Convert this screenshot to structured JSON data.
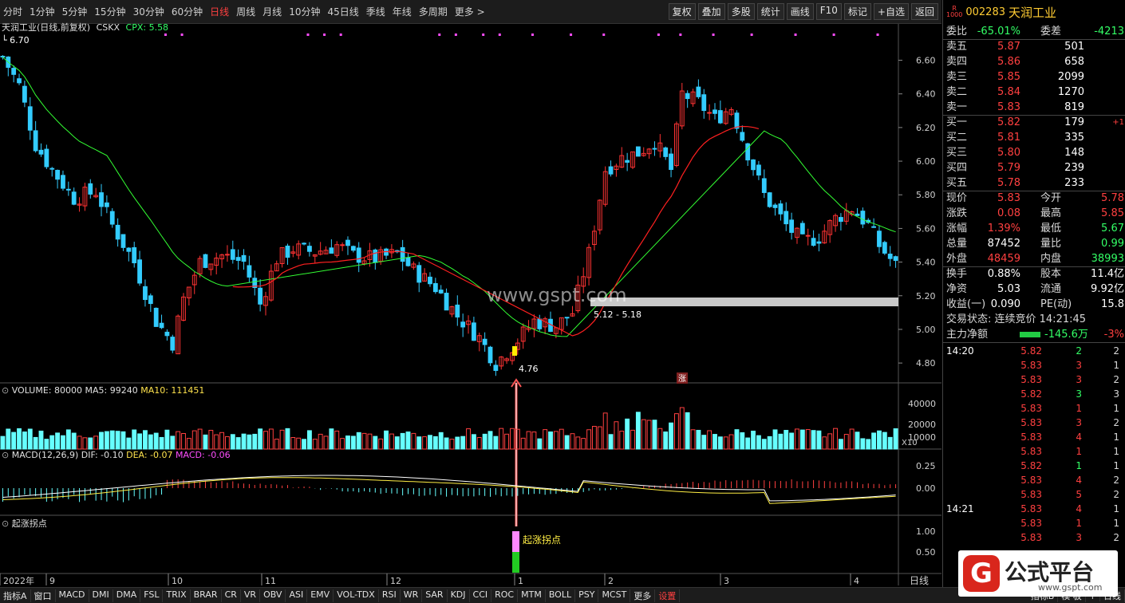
{
  "periods": [
    "分时",
    "1分钟",
    "5分钟",
    "15分钟",
    "30分钟",
    "60分钟",
    "日线",
    "周线",
    "月线",
    "10分钟",
    "45日线",
    "季线",
    "年线",
    "多周期",
    "更多 >"
  ],
  "active_period": "日线",
  "toolbar": [
    "复权",
    "叠加",
    "多股",
    "统计",
    "画线",
    "F10",
    "标记",
    "+自选",
    "返回"
  ],
  "main_title": "天润工业(日线,前复权)",
  "main_ind": "CSKX",
  "main_cpx": "CPX: 5.58",
  "high_label": "6.70",
  "low_label": "4.76",
  "range_label": "5.12 - 5.18",
  "watermark": "www.gspt.com",
  "rise_badge": "涨",
  "vol_title": "VOLUME: 80000",
  "vol_ma5": "MA5: 99240",
  "vol_ma10": "MA10: 111451",
  "macd_title": "MACD(12,26,9)",
  "macd_dif": "DIF: -0.10",
  "macd_dea": "DEA: -0.07",
  "macd_macd": "MACD: -0.06",
  "sig_title": "起涨拐点",
  "sig_label": "起涨拐点",
  "price_ticks": [
    "6.60",
    "6.40",
    "6.20",
    "6.00",
    "5.80",
    "5.60",
    "5.40",
    "5.20",
    "5.00",
    "4.80"
  ],
  "vol_ticks": [
    "40000",
    "20000",
    "10000"
  ],
  "vol_unit": "X10",
  "macd_ticks": [
    "0.25",
    "0.00"
  ],
  "sig_ticks": [
    "1.00",
    "0.50"
  ],
  "date_labels": [
    "2022年",
    "9",
    "10",
    "11",
    "12",
    "1",
    "2",
    "3",
    "4"
  ],
  "date_period": "日线",
  "bottom_tabs": [
    "指标A",
    "窗口",
    "MACD",
    "DMI",
    "DMA",
    "FSL",
    "TRIX",
    "BRAR",
    "CR",
    "VR",
    "OBV",
    "ASI",
    "EMV",
    "VOL-TDX",
    "RSI",
    "WR",
    "SAR",
    "KDJ",
    "CCI",
    "ROC",
    "MTM",
    "BOLL",
    "PSY",
    "MCST",
    "更多",
    "设置"
  ],
  "bottom_right": [
    "指标B",
    "模 板",
    "+",
    "日线"
  ],
  "stock": {
    "code": "002283",
    "name": "天润工业",
    "badge_top": "R",
    "badge_bottom": "1000"
  },
  "summary": {
    "wb_label": "委比",
    "wb": "-65.01%",
    "wc_label": "委差",
    "wc": "-4213"
  },
  "orderbook": [
    {
      "label": "卖五",
      "price": "5.87",
      "vol": "501",
      "chg": ""
    },
    {
      "label": "卖四",
      "price": "5.86",
      "vol": "658",
      "chg": ""
    },
    {
      "label": "卖三",
      "price": "5.85",
      "vol": "2099",
      "chg": ""
    },
    {
      "label": "卖二",
      "price": "5.84",
      "vol": "1270",
      "chg": ""
    },
    {
      "label": "卖一",
      "price": "5.83",
      "vol": "819",
      "chg": ""
    },
    {
      "label": "买一",
      "price": "5.82",
      "vol": "179",
      "chg": "+1"
    },
    {
      "label": "买二",
      "price": "5.81",
      "vol": "335",
      "chg": ""
    },
    {
      "label": "买三",
      "price": "5.80",
      "vol": "148",
      "chg": ""
    },
    {
      "label": "买四",
      "price": "5.79",
      "vol": "239",
      "chg": ""
    },
    {
      "label": "买五",
      "price": "5.78",
      "vol": "233",
      "chg": ""
    }
  ],
  "quote": [
    {
      "l1": "现价",
      "v1": "5.83",
      "c1": "r",
      "l2": "今开",
      "v2": "5.78",
      "c2": "r"
    },
    {
      "l1": "涨跌",
      "v1": "0.08",
      "c1": "r",
      "l2": "最高",
      "v2": "5.85",
      "c2": "r"
    },
    {
      "l1": "涨幅",
      "v1": "1.39%",
      "c1": "r",
      "l2": "最低",
      "v2": "5.67",
      "c2": "g"
    },
    {
      "l1": "总量",
      "v1": "87452",
      "c1": "w",
      "l2": "量比",
      "v2": "0.99",
      "c2": "g"
    },
    {
      "l1": "外盘",
      "v1": "48459",
      "c1": "r",
      "l2": "内盘",
      "v2": "38993",
      "c2": "g"
    }
  ],
  "stats": [
    {
      "l1": "换手",
      "v1": "0.88%",
      "l2": "股本",
      "v2": "11.4亿"
    },
    {
      "l1": "净资",
      "v1": "5.03",
      "l2": "流通",
      "v2": "9.92亿"
    },
    {
      "l1": "收益(一)",
      "v1": "0.090",
      "l2": "PE(动)",
      "v2": "15.8"
    }
  ],
  "trade_status": "交易状态: 连续竞价 14:21:45",
  "main_net_label": "主力净额",
  "main_net": "-145.6万",
  "main_net_pct": "-3%",
  "ticks": [
    {
      "t": "14:20",
      "p": "5.82",
      "c": "r",
      "v": "2",
      "vc": "g",
      "n": "2"
    },
    {
      "t": "",
      "p": "5.83",
      "c": "r",
      "v": "3",
      "vc": "r",
      "n": "1"
    },
    {
      "t": "",
      "p": "5.83",
      "c": "r",
      "v": "3",
      "vc": "r",
      "n": "2"
    },
    {
      "t": "",
      "p": "5.82",
      "c": "r",
      "v": "3",
      "vc": "g",
      "n": "3"
    },
    {
      "t": "",
      "p": "5.83",
      "c": "r",
      "v": "1",
      "vc": "r",
      "n": "1"
    },
    {
      "t": "",
      "p": "5.83",
      "c": "r",
      "v": "3",
      "vc": "r",
      "n": "2"
    },
    {
      "t": "",
      "p": "5.83",
      "c": "r",
      "v": "4",
      "vc": "r",
      "n": "1"
    },
    {
      "t": "",
      "p": "5.83",
      "c": "r",
      "v": "1",
      "vc": "r",
      "n": "1"
    },
    {
      "t": "",
      "p": "5.82",
      "c": "r",
      "v": "1",
      "vc": "g",
      "n": "1"
    },
    {
      "t": "",
      "p": "5.83",
      "c": "r",
      "v": "4",
      "vc": "r",
      "n": "2"
    },
    {
      "t": "",
      "p": "5.83",
      "c": "r",
      "v": "5",
      "vc": "r",
      "n": "2"
    },
    {
      "t": "14:21",
      "p": "5.83",
      "c": "r",
      "v": "4",
      "vc": "r",
      "n": "1"
    },
    {
      "t": "",
      "p": "5.83",
      "c": "r",
      "v": "1",
      "vc": "r",
      "n": "1"
    },
    {
      "t": "",
      "p": "5.83",
      "c": "r",
      "v": "3",
      "vc": "r",
      "n": "2"
    }
  ],
  "logo_text": "公式平台",
  "logo_url": "www.gspt.com",
  "colors": {
    "up": "#ff3333",
    "down": "#33ccff",
    "ma_green": "#33ff33",
    "ma_red": "#ff2020"
  }
}
